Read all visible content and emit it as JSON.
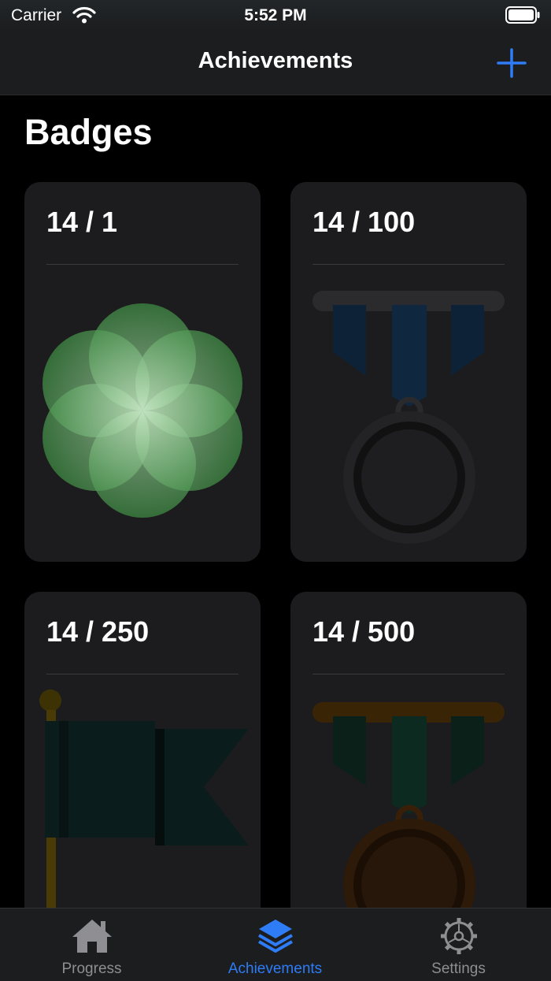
{
  "status": {
    "carrier": "Carrier",
    "time": "5:52 PM"
  },
  "nav": {
    "title": "Achievements",
    "add_icon": "plus-icon"
  },
  "section": {
    "title": "Badges"
  },
  "badges": [
    {
      "label": "14 / 1",
      "icon": "flower-badge-icon"
    },
    {
      "label": "14 / 100",
      "icon": "medal-icon"
    },
    {
      "label": "14 / 250",
      "icon": "flag-icon"
    },
    {
      "label": "14 / 500",
      "icon": "bronze-medal-icon"
    }
  ],
  "tabs": [
    {
      "label": "Progress",
      "icon": "house-icon",
      "active": false
    },
    {
      "label": "Achievements",
      "icon": "layers-icon",
      "active": true
    },
    {
      "label": "Settings",
      "icon": "gear-icon",
      "active": false
    }
  ],
  "colors": {
    "accent": "#2e7cf6",
    "background": "#000000",
    "card": "#1c1c1e"
  }
}
